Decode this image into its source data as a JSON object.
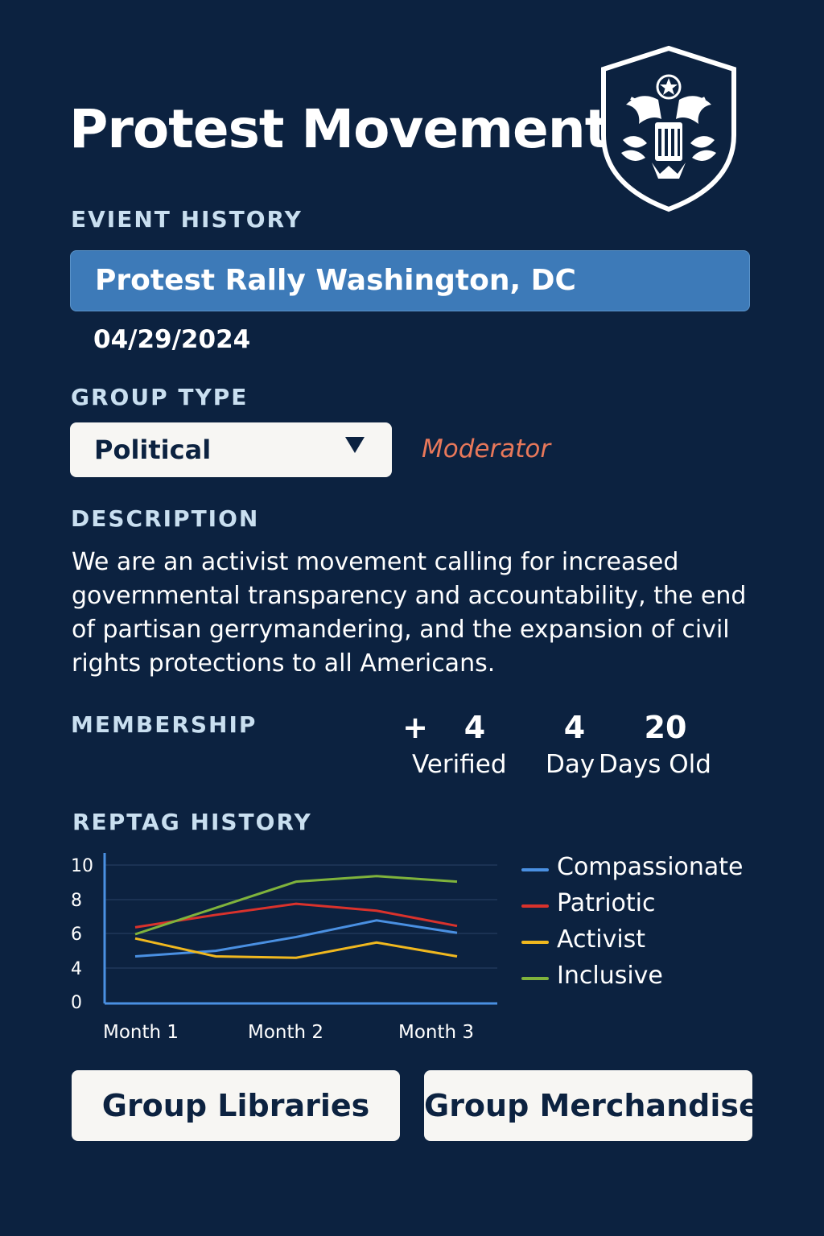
{
  "header": {
    "title": "Protest Movement"
  },
  "event_history": {
    "label": "EVIENT HISTORY",
    "event_name": "Protest Rally Washington, DC",
    "date": "04/29/2024"
  },
  "group_type": {
    "label": "GROUP TYPE",
    "selected": "Political",
    "role": "Moderator"
  },
  "description": {
    "label": "DESCRIPTION",
    "text": "We are an activist movement calling for increased governmental transparency and accountability, the end of partisan gerrymandering, and the expansion of civil rights protections to all Americans."
  },
  "membership": {
    "label": "MEMBERSHIP",
    "plus": "+",
    "verified_count": "4",
    "verified_label": "Verified",
    "day_count": "4",
    "day_label": "Day",
    "days_old_count": "20",
    "days_old_label": "Days Old"
  },
  "reptag": {
    "label": "REPTAG HISTORY"
  },
  "chart_data": {
    "type": "line",
    "title": "",
    "xlabel": "",
    "ylabel": "",
    "x_ticks": [
      "Month 1",
      "Month 2",
      "Month 3"
    ],
    "y_ticks": [
      "10",
      "8",
      "6",
      "4",
      "0"
    ],
    "legend_position": "right",
    "grid": true,
    "series": [
      {
        "name": "Compassionate",
        "color": "#4a90e2",
        "values": [
          3.4,
          3.8,
          4.8,
          6.0,
          5.1
        ]
      },
      {
        "name": "Patriotic",
        "color": "#d9322c",
        "values": [
          5.5,
          6.4,
          7.2,
          6.7,
          5.6
        ]
      },
      {
        "name": "Activist",
        "color": "#f0b81f",
        "values": [
          4.7,
          3.4,
          3.3,
          4.4,
          3.4
        ]
      },
      {
        "name": "Inclusive",
        "color": "#7fb33c",
        "values": [
          5.0,
          6.9,
          8.8,
          9.2,
          8.8
        ]
      }
    ]
  },
  "buttons": {
    "libraries": "Group Libraries",
    "merchandise": "Group Merchandise"
  }
}
